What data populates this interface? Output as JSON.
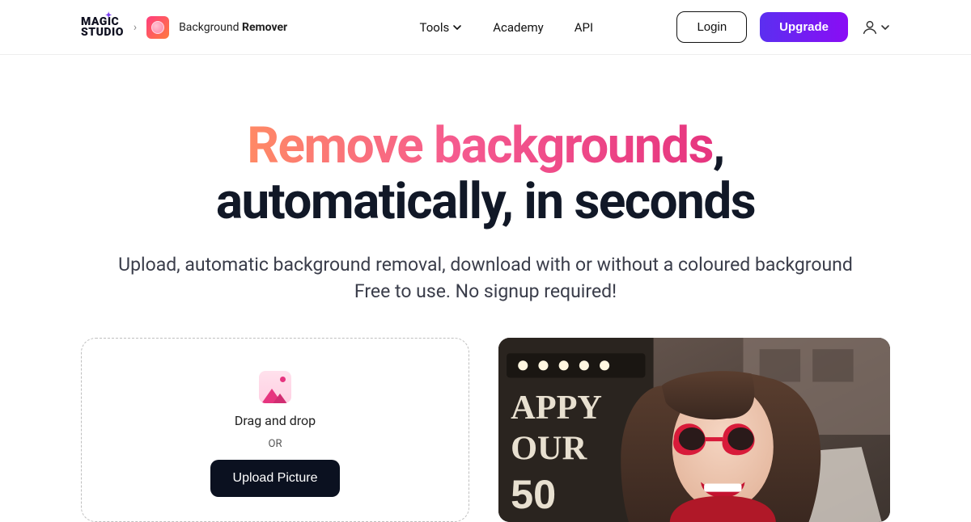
{
  "header": {
    "logo_line1": "MAGIC",
    "logo_line2": "STUDIO",
    "app_name_prefix": "Background ",
    "app_name_bold": "Remover",
    "nav": {
      "tools": "Tools",
      "academy": "Academy",
      "api": "API"
    },
    "login": "Login",
    "upgrade": "Upgrade"
  },
  "hero": {
    "headline_gradient": "Remove backgrounds",
    "headline_rest": "automatically, in seconds",
    "sub_line1": "Upload, automatic background removal, download with or without a coloured background",
    "sub_line2": "Free to use. No signup required!"
  },
  "upload": {
    "drag_drop": "Drag and drop",
    "or": "OR",
    "button": "Upload Picture"
  }
}
